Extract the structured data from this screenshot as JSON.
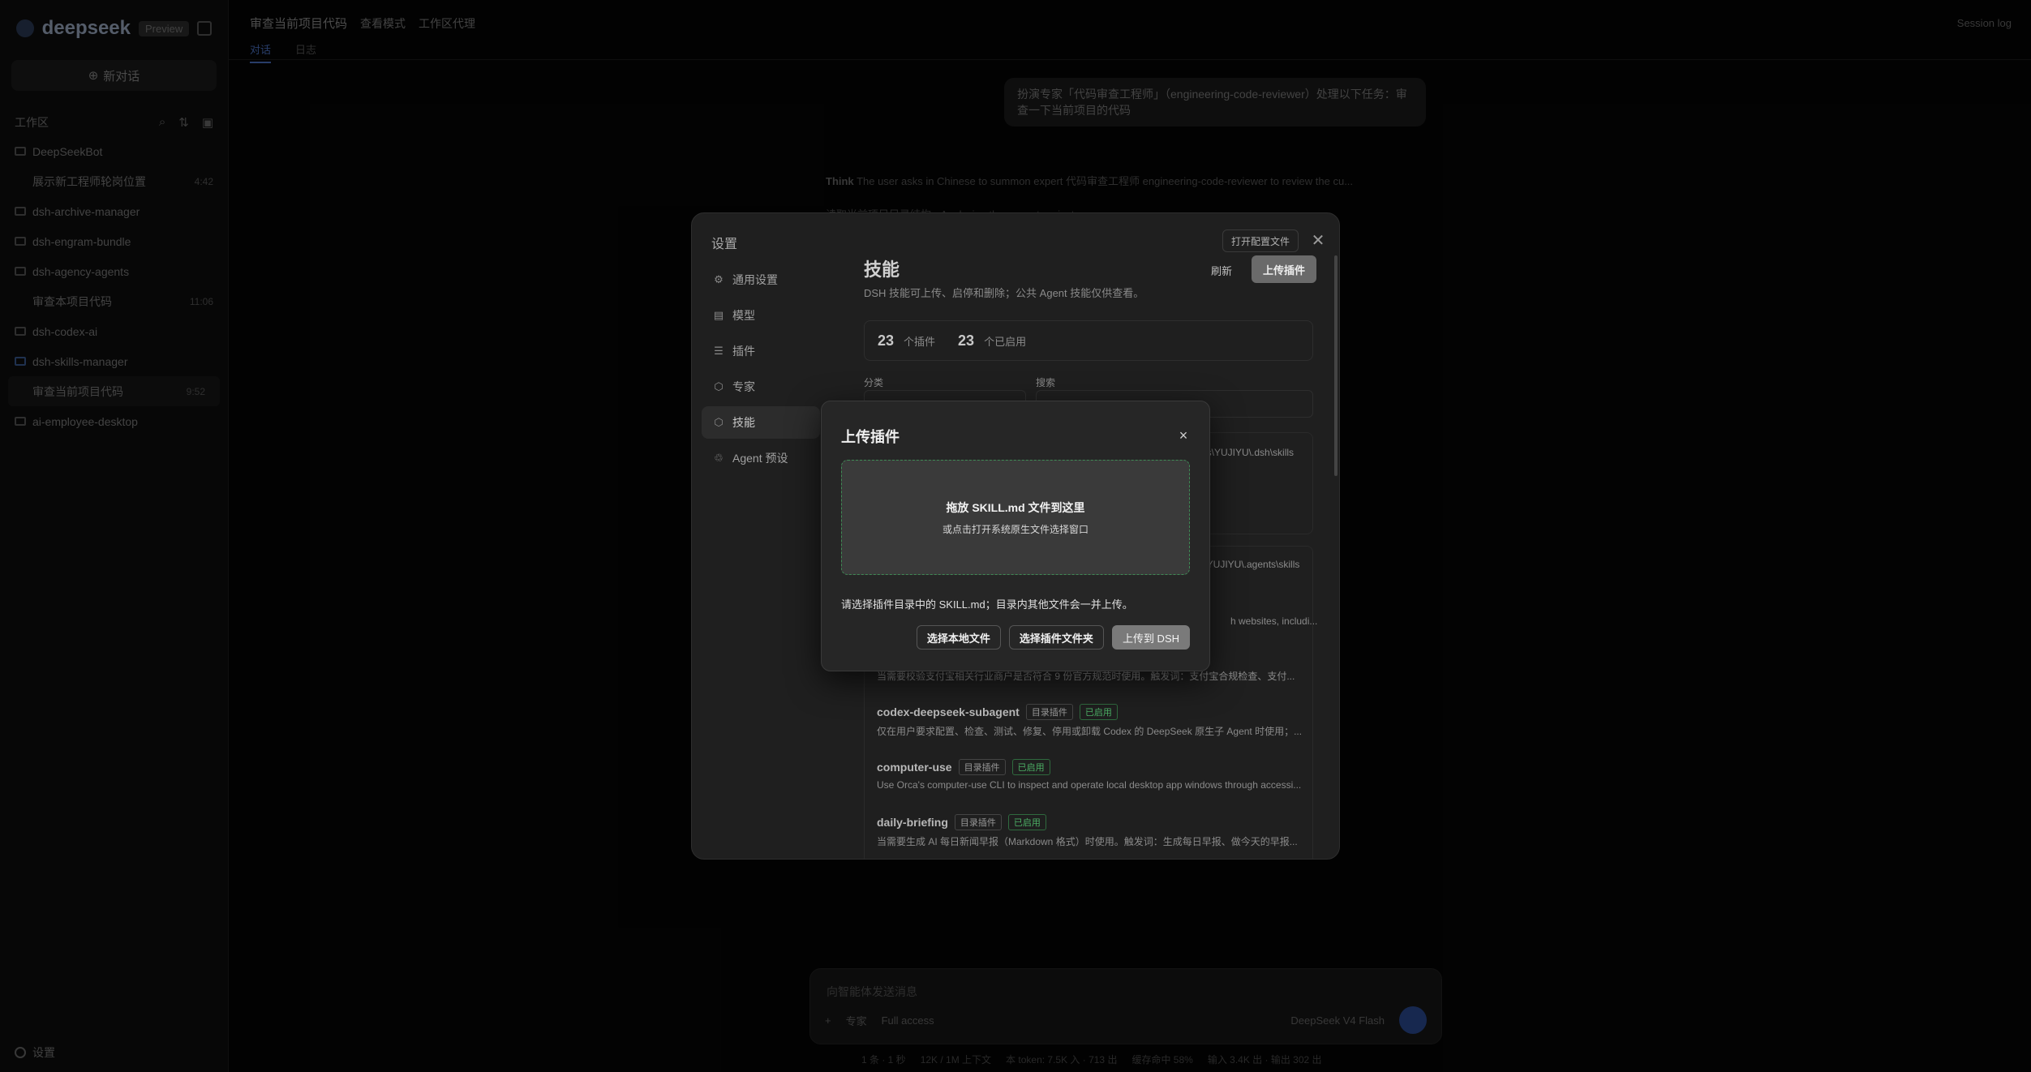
{
  "app": {
    "logo": "deepseek",
    "badge": "Preview",
    "new_chat": "新对话",
    "workspace_label": "工作区",
    "footer_settings": "设置"
  },
  "tree": [
    {
      "label": "DeepSeekBot",
      "meta": "",
      "type": "folder"
    },
    {
      "label": "展示新工程师轮岗位置",
      "meta": "4:42",
      "type": "sub"
    },
    {
      "label": "dsh-archive-manager",
      "meta": "",
      "type": "folder"
    },
    {
      "label": "dsh-engram-bundle",
      "meta": "",
      "type": "folder"
    },
    {
      "label": "dsh-agency-agents",
      "meta": "",
      "type": "folder"
    },
    {
      "label": "审查本项目代码",
      "meta": "11:06",
      "type": "sub"
    },
    {
      "label": "dsh-codex-ai",
      "meta": "",
      "type": "folder"
    },
    {
      "label": "dsh-skills-manager",
      "meta": "",
      "type": "folder-blue"
    },
    {
      "label": "审查当前项目代码",
      "meta": "9:52",
      "type": "active"
    },
    {
      "label": "ai-employee-desktop",
      "meta": "",
      "type": "folder"
    }
  ],
  "topbar": {
    "title": "审查当前项目代码",
    "chip1": "查看模式",
    "chip2": "工作区代理",
    "right": "Session log",
    "tabs": [
      "对话",
      "日志"
    ]
  },
  "chat": {
    "bubble": "扮演专家「代码审查工程师」（engineering-code-reviewer）处理以下任务：审查一下当前项目的代码",
    "think_label": "Think",
    "think_text": "The user asks in Chinese to summon expert 代码审查工程师 engineering-code-reviewer to review the cu...",
    "bg_line": "读取当前项目目录结构 · Analyzing the current project ..."
  },
  "composer": {
    "placeholder": "向智能体发送消息",
    "attach": "+",
    "expert": "专家",
    "access": "Full access",
    "model": "DeepSeek V4 Flash",
    "status": [
      "1 条 · 1 秒",
      "12K / 1M 上下文",
      "本 token: 7.5K 入 · 713 出",
      "缓存命中 58%",
      "输入 3.4K 出 · 输出 302 出"
    ]
  },
  "settings": {
    "title": "设置",
    "nav": [
      {
        "label": "通用设置",
        "icon": "gear-icon",
        "glyph": "⚙"
      },
      {
        "label": "模型",
        "icon": "database-icon",
        "glyph": "▤"
      },
      {
        "label": "插件",
        "icon": "sliders-icon",
        "glyph": "☰"
      },
      {
        "label": "专家",
        "icon": "hexagon-icon",
        "glyph": "⬡"
      },
      {
        "label": "技能",
        "icon": "hexagon-icon",
        "glyph": "⬡"
      },
      {
        "label": "Agent 预设",
        "icon": "recycle-icon",
        "glyph": "♲"
      }
    ],
    "active_nav": 4,
    "open_config": "打开配置文件",
    "section_title": "技能",
    "section_desc": "DSH 技能可上传、启停和删除；公共 Agent 技能仅供查看。",
    "refresh": "刷新",
    "upload": "上传插件",
    "count_plugins": "23",
    "count_plugins_label": "个插件",
    "count_enabled": "23",
    "count_enabled_label": "个已启用",
    "category_label": "分类",
    "search_label": "搜索",
    "path1": "es\\YUJIYU\\.dsh\\skills",
    "path2": ":\\YUJIYU\\.agents\\skills",
    "partial_desc1": "h websites, includi...",
    "partial_desc2": "当需要校验支付宝相关行业商户是否符合 9 份官方规范时使用。触发词：支付宝合规检查、支付...",
    "skills": [
      {
        "name": "codex-deepseek-subagent",
        "tag": "目录插件",
        "status": "已启用",
        "desc": "仅在用户要求配置、检查、测试、修复、停用或卸载 Codex 的 DeepSeek 原生子 Agent 时使用；..."
      },
      {
        "name": "computer-use",
        "tag": "目录插件",
        "status": "已启用",
        "desc": "Use Orca's computer-use CLI to inspect and operate local desktop app windows through accessi..."
      },
      {
        "name": "daily-briefing",
        "tag": "目录插件",
        "status": "已启用",
        "desc": "当需要生成 AI 每日新闻早报（Markdown 格式）时使用。触发词：生成每日早报、做今天的早报..."
      }
    ]
  },
  "upload_dialog": {
    "title": "上传插件",
    "close": "×",
    "drop_title": "拖放 SKILL.md 文件到这里",
    "drop_sub": "或点击打开系统原生文件选择窗口",
    "hint": "请选择插件目录中的 SKILL.md；目录内其他文件会一并上传。",
    "btn_file": "选择本地文件",
    "btn_folder": "选择插件文件夹",
    "btn_upload": "上传到 DSH"
  },
  "colors": {
    "accent_green": "#3f8a55",
    "enabled_green": "#4caf65",
    "primary_button": "#7a7a7a"
  }
}
